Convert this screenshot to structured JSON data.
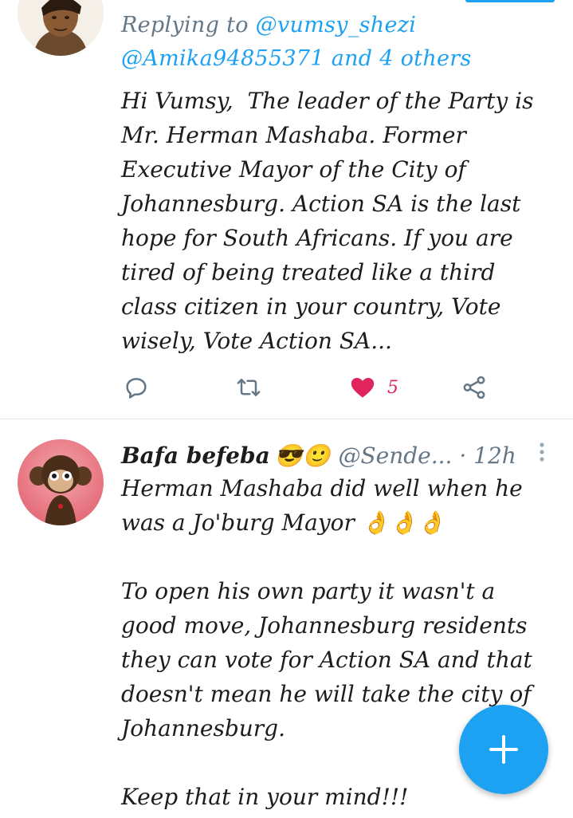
{
  "tweet1": {
    "reply_prefix": "Replying to ",
    "reply_user": "@vumsy_shezi",
    "reply_line2": "@Amika94855371 and 4 others",
    "text": "Hi Vumsy,  The leader of the Party is\nMr. Herman Mashaba. Former\nExecutive Mayor of the City of\nJohannesburg. Action SA is the last\nhope for South Africans. If you are\ntired of being treated like a third\nclass citizen in your country, Vote\nwisely, Vote Action SA...",
    "like_count": "5",
    "liked": true
  },
  "tweet2": {
    "display_name": "Bafa befeba",
    "emojis": "😎🙂",
    "handle_time": "@Sende... · 12h",
    "text": "Herman Mashaba did well when he\nwas a Jo'burg Mayor 👌👌👌\n\nTo open his own party it wasn't a\ngood move, Johannesburg residents\nthey can vote for Action SA and that\ndoesn't mean he will take the city of\nJohannesburg.\n\nKeep that in your mind!!!"
  },
  "icons": {
    "reply": "reply-icon",
    "retweet": "retweet-icon",
    "like": "heart-icon",
    "share": "share-icon",
    "more": "more-options-icon",
    "compose": "plus-icon"
  },
  "colors": {
    "accent": "#1da1f2",
    "like": "#e0245e",
    "muted": "#657786"
  }
}
